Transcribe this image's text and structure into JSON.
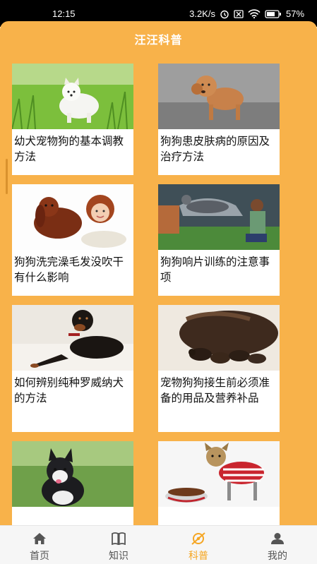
{
  "status_bar": {
    "time": "12:15",
    "network_speed": "3.2K/s",
    "battery": "57",
    "icons": [
      "alarm-icon",
      "sim-off-icon",
      "wifi-icon",
      "battery-icon"
    ]
  },
  "header": {
    "title": "汪汪科普"
  },
  "articles": [
    {
      "title": "幼犬宠物狗的基本调教方法",
      "image": "white-puppy-on-grass"
    },
    {
      "title": "狗狗患皮肤病的原因及治疗方法",
      "image": "poodle-puppy-walking"
    },
    {
      "title": "狗狗洗完澡毛发没吹干有什么影响",
      "image": "girl-with-spaniel"
    },
    {
      "title": "狗狗响片训练的注意事项",
      "image": "border-collie-jumping"
    },
    {
      "title": "如何辨别纯种罗威纳犬的方法",
      "image": "rottweiler-lying"
    },
    {
      "title": "宠物狗狗接生前必须准备的用品及营养补品",
      "image": "mother-dog-with-puppies"
    },
    {
      "title": "",
      "image": "husky-puppy"
    },
    {
      "title": "",
      "image": "yorkie-with-food-bowl"
    }
  ],
  "tabbar": {
    "tabs": [
      {
        "label": "首页",
        "icon": "home-icon",
        "active": false
      },
      {
        "label": "知识",
        "icon": "book-icon",
        "active": false
      },
      {
        "label": "科普",
        "icon": "science-icon",
        "active": true
      },
      {
        "label": "我的",
        "icon": "user-icon",
        "active": false
      }
    ]
  },
  "colors": {
    "accent": "#f8b24a",
    "active_tab": "#f5a623"
  }
}
